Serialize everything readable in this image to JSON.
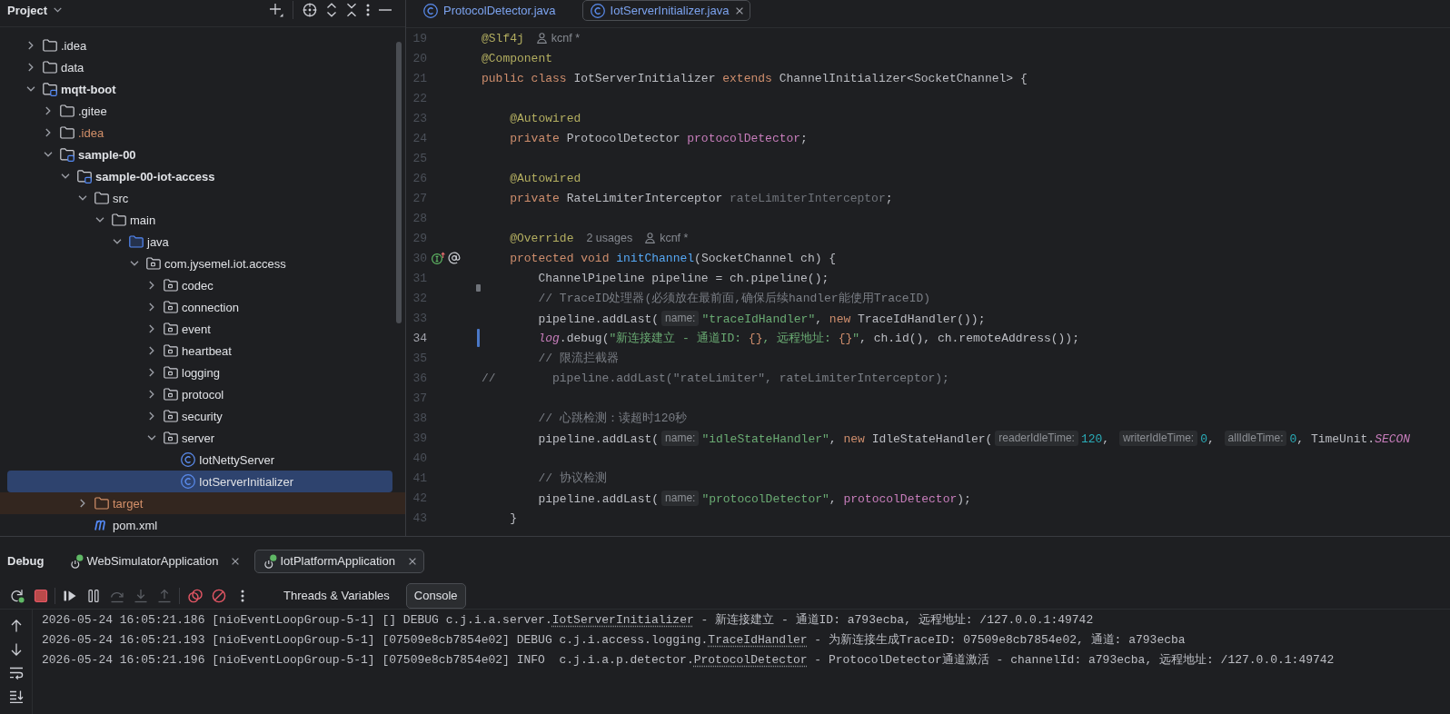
{
  "project": {
    "title": "Project",
    "tree": [
      {
        "name": ".idea",
        "kind": "folder",
        "ignored": false,
        "excluded": false,
        "expanded": false,
        "selected": false
      },
      {
        "name": "data",
        "kind": "folder",
        "ignored": false,
        "excluded": false,
        "expanded": false,
        "selected": false
      },
      {
        "name": "mqtt-boot",
        "kind": "module",
        "ignored": false,
        "excluded": false,
        "expanded": true,
        "selected": false,
        "children": [
          {
            "name": ".gitee",
            "kind": "folder",
            "ignored": false,
            "excluded": false,
            "expanded": false,
            "selected": false
          },
          {
            "name": ".idea",
            "kind": "folder",
            "ignored": true,
            "excluded": false,
            "expanded": false,
            "selected": false
          },
          {
            "name": "sample-00",
            "kind": "module",
            "ignored": false,
            "excluded": false,
            "expanded": true,
            "selected": false,
            "children": [
              {
                "name": "sample-00-iot-access",
                "kind": "module",
                "ignored": false,
                "excluded": false,
                "expanded": true,
                "selected": false,
                "children": [
                  {
                    "name": "src",
                    "kind": "folder",
                    "ignored": false,
                    "excluded": false,
                    "expanded": true,
                    "selected": false,
                    "children": [
                      {
                        "name": "main",
                        "kind": "folder",
                        "ignored": false,
                        "excluded": false,
                        "expanded": true,
                        "selected": false,
                        "children": [
                          {
                            "name": "java",
                            "kind": "source-root",
                            "ignored": false,
                            "excluded": false,
                            "expanded": true,
                            "selected": false,
                            "children": [
                              {
                                "name": "com.jysemel.iot.access",
                                "kind": "package",
                                "ignored": false,
                                "excluded": false,
                                "expanded": true,
                                "selected": false,
                                "children": [
                                  {
                                    "name": "codec",
                                    "kind": "package",
                                    "ignored": false,
                                    "excluded": false,
                                    "expanded": false,
                                    "selected": false
                                  },
                                  {
                                    "name": "connection",
                                    "kind": "package",
                                    "ignored": false,
                                    "excluded": false,
                                    "expanded": false,
                                    "selected": false
                                  },
                                  {
                                    "name": "event",
                                    "kind": "package",
                                    "ignored": false,
                                    "excluded": false,
                                    "expanded": false,
                                    "selected": false
                                  },
                                  {
                                    "name": "heartbeat",
                                    "kind": "package",
                                    "ignored": false,
                                    "excluded": false,
                                    "expanded": false,
                                    "selected": false
                                  },
                                  {
                                    "name": "logging",
                                    "kind": "package",
                                    "ignored": false,
                                    "excluded": false,
                                    "expanded": false,
                                    "selected": false
                                  },
                                  {
                                    "name": "protocol",
                                    "kind": "package",
                                    "ignored": false,
                                    "excluded": false,
                                    "expanded": false,
                                    "selected": false
                                  },
                                  {
                                    "name": "security",
                                    "kind": "package",
                                    "ignored": false,
                                    "excluded": false,
                                    "expanded": false,
                                    "selected": false
                                  },
                                  {
                                    "name": "server",
                                    "kind": "package",
                                    "ignored": false,
                                    "excluded": false,
                                    "expanded": true,
                                    "selected": false,
                                    "children": [
                                      {
                                        "name": "IotNettyServer",
                                        "kind": "class",
                                        "ignored": false,
                                        "excluded": false,
                                        "selected": false
                                      },
                                      {
                                        "name": "IotServerInitializer",
                                        "kind": "class",
                                        "ignored": false,
                                        "excluded": false,
                                        "selected": true
                                      }
                                    ]
                                  }
                                ]
                              }
                            ]
                          }
                        ]
                      }
                    ]
                  },
                  {
                    "name": "target",
                    "kind": "folder",
                    "ignored": false,
                    "excluded": true,
                    "expanded": false,
                    "selected": false
                  },
                  {
                    "name": "pom.xml",
                    "kind": "maven",
                    "ignored": false,
                    "excluded": false,
                    "selected": false
                  }
                ]
              }
            ]
          }
        ]
      }
    ]
  },
  "editor": {
    "tabs": [
      {
        "label": "ProtocolDetector.java",
        "selected": false
      },
      {
        "label": "IotServerInitializer.java",
        "selected": true
      }
    ],
    "lines": [
      {
        "number": "19",
        "current": false,
        "tokens": [
          {
            "kind": "annotation",
            "text": "@Slf4j"
          },
          {
            "kind": "author",
            "text": "kcnf *"
          }
        ]
      },
      {
        "number": "20",
        "current": false,
        "tokens": [
          {
            "kind": "annotation",
            "text": "@Component"
          }
        ]
      },
      {
        "number": "21",
        "current": false,
        "tokens": [
          {
            "kind": "keyword",
            "text": "public class"
          },
          {
            "kind": "plain",
            "text": " IotServerInitializer "
          },
          {
            "kind": "keyword",
            "text": "extends"
          },
          {
            "kind": "plain",
            "text": " ChannelInitializer<SocketChannel> {"
          }
        ]
      },
      {
        "number": "22",
        "current": false
      },
      {
        "number": "23",
        "current": false,
        "tokens": [
          {
            "kind": "annotation",
            "text": "    @Autowired"
          }
        ]
      },
      {
        "number": "24",
        "current": false,
        "tokens": [
          {
            "kind": "keyword",
            "text": "    private"
          },
          {
            "kind": "plain",
            "text": " ProtocolDetector "
          },
          {
            "kind": "field",
            "text": "protocolDetector"
          },
          {
            "kind": "plain",
            "text": ";"
          }
        ]
      },
      {
        "number": "25",
        "current": false
      },
      {
        "number": "26",
        "current": false,
        "tokens": [
          {
            "kind": "annotation",
            "text": "    @Autowired"
          }
        ]
      },
      {
        "number": "27",
        "current": false,
        "tokens": [
          {
            "kind": "keyword",
            "text": "    private"
          },
          {
            "kind": "plain",
            "text": " RateLimiterInterceptor "
          },
          {
            "kind": "unused",
            "text": "rateLimiterInterceptor"
          },
          {
            "kind": "plain",
            "text": ";"
          }
        ]
      },
      {
        "number": "28",
        "current": false
      },
      {
        "number": "29",
        "current": false,
        "tokens": [
          {
            "kind": "annotation",
            "text": "    @Override"
          },
          {
            "kind": "usages",
            "text": "2 usages"
          },
          {
            "kind": "author",
            "text": "kcnf *"
          }
        ]
      },
      {
        "number": "30",
        "current": false,
        "gutter_icons": [
          {
            "kind": "override"
          },
          {
            "kind": "at"
          }
        ],
        "tokens": [
          {
            "kind": "keyword",
            "text": "    protected void "
          },
          {
            "kind": "method",
            "text": "initChannel"
          },
          {
            "kind": "plain",
            "text": "(SocketChannel ch) {"
          }
        ]
      },
      {
        "number": "31",
        "current": false,
        "tokens": [
          {
            "kind": "plain",
            "text": "        ChannelPipeline pipeline = ch.pipeline();"
          }
        ]
      },
      {
        "number": "32",
        "current": false,
        "marker": {
          "kind": "deleted"
        },
        "tokens": [
          {
            "kind": "comment",
            "text": "        // TraceID处理器(必须放在最前面,确保后续handler能使用TraceID)"
          }
        ]
      },
      {
        "number": "33",
        "current": false,
        "tokens": [
          {
            "kind": "plain",
            "text": "        pipeline.addLast("
          },
          {
            "kind": "hint",
            "text": "name:"
          },
          {
            "kind": "string",
            "text": "\"traceIdHandler\""
          },
          {
            "kind": "plain",
            "text": ", "
          },
          {
            "kind": "keyword",
            "text": "new"
          },
          {
            "kind": "plain",
            "text": " TraceIdHandler());"
          }
        ]
      },
      {
        "number": "34",
        "current": true,
        "marker": {
          "kind": "modified"
        },
        "tokens": [
          {
            "kind": "static",
            "text": "        log"
          },
          {
            "kind": "plain",
            "text": ".debug("
          },
          {
            "kind": "string",
            "text": "\"新连接建立 - 通道ID: "
          },
          {
            "kind": "placeholder",
            "text": "{}"
          },
          {
            "kind": "string",
            "text": ", 远程地址: "
          },
          {
            "kind": "placeholder",
            "text": "{}"
          },
          {
            "kind": "string",
            "text": "\""
          },
          {
            "kind": "plain",
            "text": ", ch.id(), ch.remoteAddress());"
          }
        ]
      },
      {
        "number": "35",
        "current": false,
        "tokens": [
          {
            "kind": "comment",
            "text": "        // 限流拦截器"
          }
        ]
      },
      {
        "number": "36",
        "current": false,
        "tokens": [
          {
            "kind": "comment",
            "text": "//        pipeline.addLast(\"rateLimiter\", rateLimiterInterceptor);"
          }
        ]
      },
      {
        "number": "37",
        "current": false
      },
      {
        "number": "38",
        "current": false,
        "tokens": [
          {
            "kind": "comment",
            "text": "        // 心跳检测：读超时120秒"
          }
        ]
      },
      {
        "number": "39",
        "current": false,
        "tokens": [
          {
            "kind": "plain",
            "text": "        pipeline.addLast("
          },
          {
            "kind": "hint",
            "text": "name:"
          },
          {
            "kind": "string",
            "text": "\"idleStateHandler\""
          },
          {
            "kind": "plain",
            "text": ", "
          },
          {
            "kind": "keyword",
            "text": "new"
          },
          {
            "kind": "plain",
            "text": " IdleStateHandler("
          },
          {
            "kind": "hint",
            "text": "readerIdleTime:"
          },
          {
            "kind": "number",
            "text": "120"
          },
          {
            "kind": "plain",
            "text": ", "
          },
          {
            "kind": "hint",
            "text": "writerIdleTime:"
          },
          {
            "kind": "number",
            "text": "0"
          },
          {
            "kind": "plain",
            "text": ", "
          },
          {
            "kind": "hint",
            "text": "allIdleTime:"
          },
          {
            "kind": "number",
            "text": "0"
          },
          {
            "kind": "plain",
            "text": ", TimeUnit."
          },
          {
            "kind": "static",
            "text": "SECON"
          }
        ]
      },
      {
        "number": "40",
        "current": false
      },
      {
        "number": "41",
        "current": false,
        "tokens": [
          {
            "kind": "comment",
            "text": "        // 协议检测"
          }
        ]
      },
      {
        "number": "42",
        "current": false,
        "tokens": [
          {
            "kind": "plain",
            "text": "        pipeline.addLast("
          },
          {
            "kind": "hint",
            "text": "name:"
          },
          {
            "kind": "string",
            "text": "\"protocolDetector\""
          },
          {
            "kind": "plain",
            "text": ", "
          },
          {
            "kind": "field",
            "text": "protocolDetector"
          },
          {
            "kind": "plain",
            "text": ");"
          }
        ]
      },
      {
        "number": "43",
        "current": false,
        "tokens": [
          {
            "kind": "plain",
            "text": "    }"
          }
        ]
      }
    ]
  },
  "debug": {
    "title": "Debug",
    "tabs": [
      {
        "label": "WebSimulatorApplication",
        "selected": false
      },
      {
        "label": "IotPlatformApplication",
        "selected": true
      }
    ],
    "toolbar_groups": [
      {
        "buttons": [
          {
            "kind": "rerun",
            "disabled": false
          },
          {
            "kind": "stop",
            "disabled": false
          }
        ]
      },
      {
        "buttons": [
          {
            "kind": "resume",
            "disabled": false
          },
          {
            "kind": "pause",
            "disabled": false
          },
          {
            "kind": "step-over",
            "disabled": true
          },
          {
            "kind": "step-into",
            "disabled": true
          },
          {
            "kind": "step-out",
            "disabled": true
          }
        ]
      },
      {
        "buttons": [
          {
            "kind": "breakpoints",
            "disabled": false
          },
          {
            "kind": "mute-breakpoints",
            "disabled": false
          },
          {
            "kind": "more",
            "disabled": false
          }
        ]
      }
    ],
    "views": [
      {
        "label": "Threads & Variables",
        "selected": false
      },
      {
        "label": "Console",
        "selected": true
      }
    ],
    "console": [
      {
        "prefix": "2026-05-24 16:05:21.186 [nioEventLoopGroup-5-1] [] DEBUG c.j.i.a.server.",
        "link": "IotServerInitializer",
        "suffix": " - 新连接建立 - 通道ID: a793ecba, 远程地址: /127.0.0.1:49742"
      },
      {
        "prefix": "2026-05-24 16:05:21.193 [nioEventLoopGroup-5-1] [07509e8cb7854e02] DEBUG c.j.i.access.logging.",
        "link": "TraceIdHandler",
        "suffix": " - 为新连接生成TraceID: 07509e8cb7854e02, 通道: a793ecba"
      },
      {
        "prefix": "2026-05-24 16:05:21.196 [nioEventLoopGroup-5-1] [07509e8cb7854e02] INFO  c.j.i.a.p.detector.",
        "link": "ProtocolDetector",
        "suffix": " - ProtocolDetector通道激活 - channelId: a793ecba, 远程地址: /127.0.0.1:49742"
      }
    ]
  }
}
